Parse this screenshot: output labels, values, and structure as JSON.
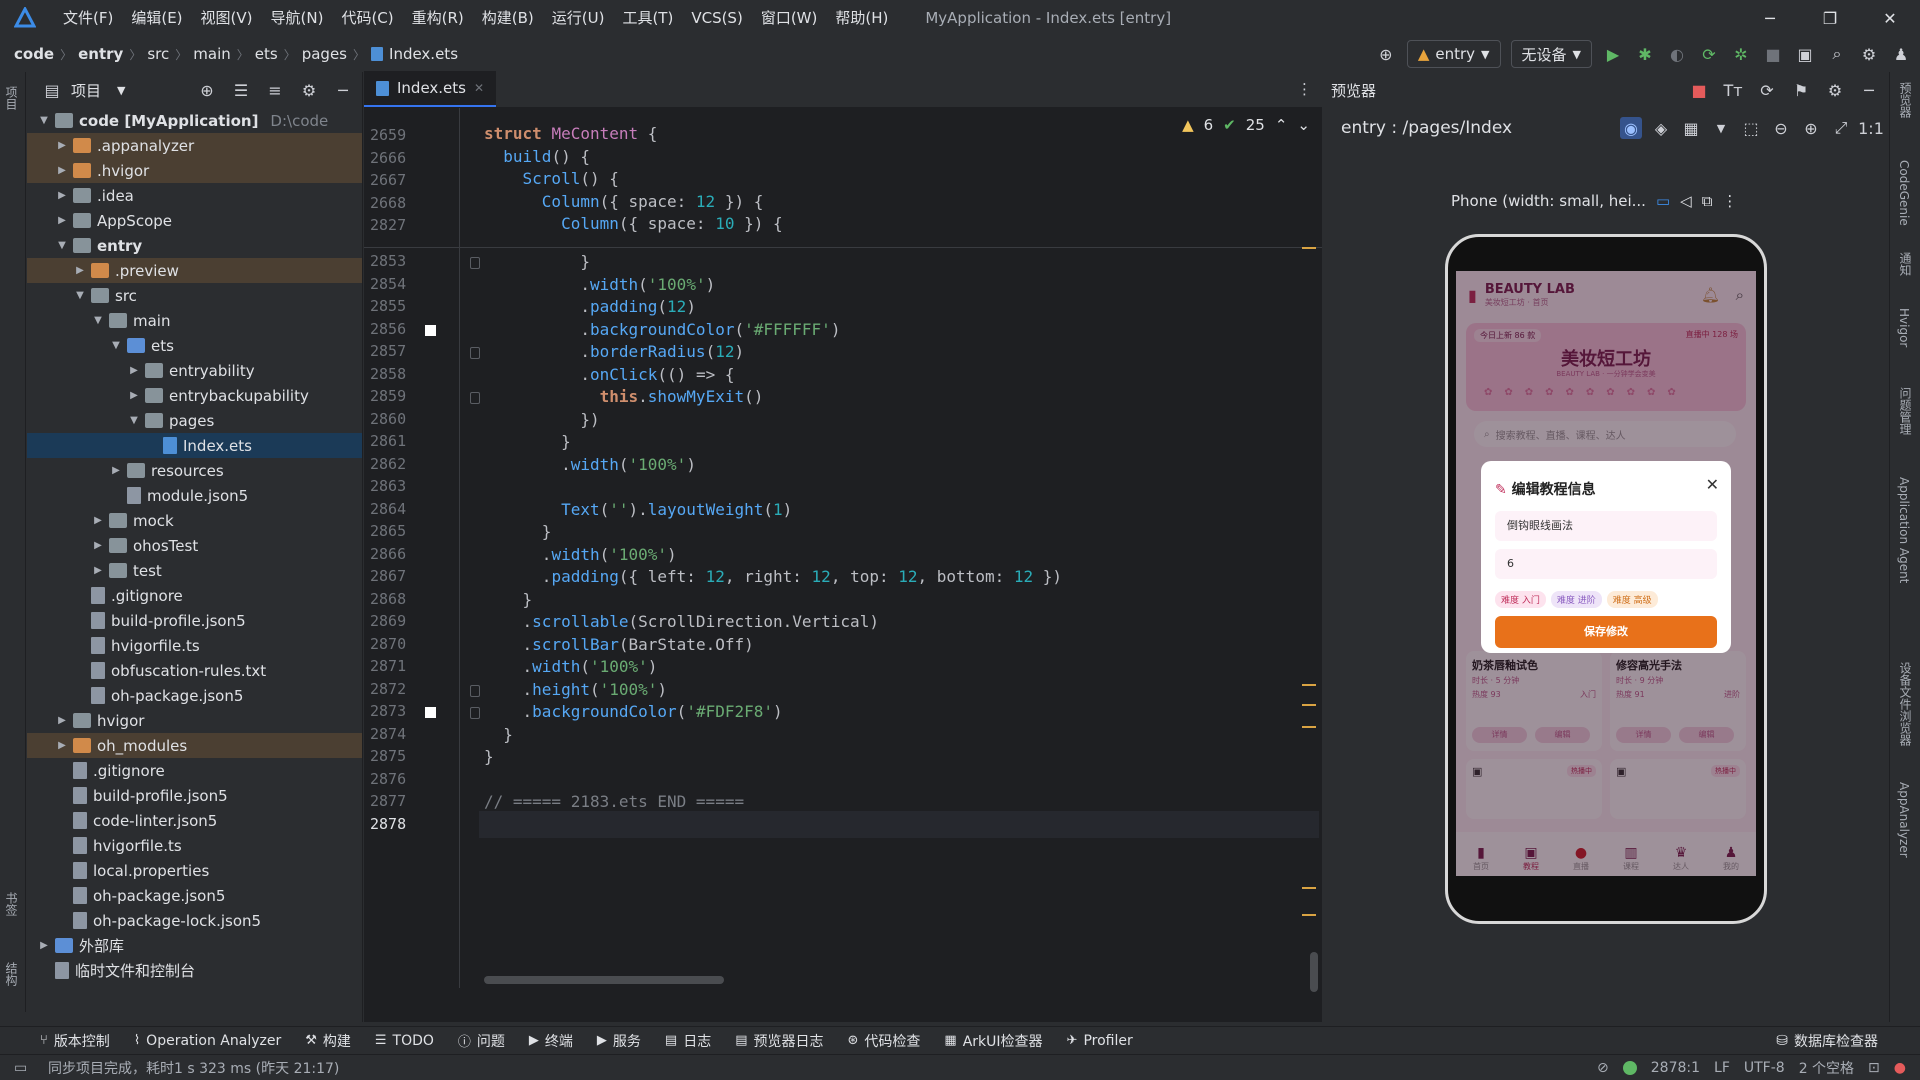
{
  "titlebar": {
    "menu": [
      "文件(F)",
      "编辑(E)",
      "视图(V)",
      "导航(N)",
      "代码(C)",
      "重构(R)",
      "构建(B)",
      "运行(U)",
      "工具(T)",
      "VCS(S)",
      "窗口(W)",
      "帮助(H)"
    ],
    "window_title": "MyApplication - Index.ets [entry]"
  },
  "breadcrumb": [
    "code",
    "entry",
    "src",
    "main",
    "ets",
    "pages",
    "Index.ets"
  ],
  "toolbar": {
    "module": "entry",
    "device": "无设备"
  },
  "project_panel": {
    "title": "项目",
    "tree": [
      {
        "depth": 0,
        "arrow": "open",
        "icon": "folder",
        "label": "code [MyApplication]",
        "hint": "D:\\code",
        "bold": true
      },
      {
        "depth": 1,
        "arrow": "closed",
        "icon": "folder-orange",
        "label": ".appanalyzer",
        "excluded": true
      },
      {
        "depth": 1,
        "arrow": "closed",
        "icon": "folder-orange",
        "label": ".hvigor",
        "excluded": true
      },
      {
        "depth": 1,
        "arrow": "closed",
        "icon": "folder",
        "label": ".idea"
      },
      {
        "depth": 1,
        "arrow": "closed",
        "icon": "folder",
        "label": "AppScope"
      },
      {
        "depth": 1,
        "arrow": "open",
        "icon": "folder",
        "label": "entry",
        "bold": true
      },
      {
        "depth": 2,
        "arrow": "closed",
        "icon": "folder-orange",
        "label": ".preview",
        "excluded": true
      },
      {
        "depth": 2,
        "arrow": "open",
        "icon": "folder",
        "label": "src"
      },
      {
        "depth": 3,
        "arrow": "open",
        "icon": "folder",
        "label": "main"
      },
      {
        "depth": 4,
        "arrow": "open",
        "icon": "folder-blue",
        "label": "ets"
      },
      {
        "depth": 5,
        "arrow": "closed",
        "icon": "folder",
        "label": "entryability"
      },
      {
        "depth": 5,
        "arrow": "closed",
        "icon": "folder",
        "label": "entrybackupability"
      },
      {
        "depth": 5,
        "arrow": "open",
        "icon": "folder",
        "label": "pages"
      },
      {
        "depth": 6,
        "arrow": "none",
        "icon": "file-ets",
        "label": "Index.ets",
        "selected": true
      },
      {
        "depth": 4,
        "arrow": "closed",
        "icon": "folder",
        "label": "resources"
      },
      {
        "depth": 4,
        "arrow": "none",
        "icon": "file",
        "label": "module.json5"
      },
      {
        "depth": 3,
        "arrow": "closed",
        "icon": "folder",
        "label": "mock"
      },
      {
        "depth": 3,
        "arrow": "closed",
        "icon": "folder",
        "label": "ohosTest"
      },
      {
        "depth": 3,
        "arrow": "closed",
        "icon": "folder",
        "label": "test"
      },
      {
        "depth": 2,
        "arrow": "none",
        "icon": "file",
        "label": ".gitignore"
      },
      {
        "depth": 2,
        "arrow": "none",
        "icon": "file",
        "label": "build-profile.json5"
      },
      {
        "depth": 2,
        "arrow": "none",
        "icon": "file",
        "label": "hvigorfile.ts"
      },
      {
        "depth": 2,
        "arrow": "none",
        "icon": "file",
        "label": "obfuscation-rules.txt"
      },
      {
        "depth": 2,
        "arrow": "none",
        "icon": "file",
        "label": "oh-package.json5"
      },
      {
        "depth": 1,
        "arrow": "closed",
        "icon": "folder",
        "label": "hvigor"
      },
      {
        "depth": 1,
        "arrow": "closed",
        "icon": "folder-orange",
        "label": "oh_modules",
        "excluded": true
      },
      {
        "depth": 1,
        "arrow": "none",
        "icon": "file",
        "label": ".gitignore"
      },
      {
        "depth": 1,
        "arrow": "none",
        "icon": "file",
        "label": "build-profile.json5"
      },
      {
        "depth": 1,
        "arrow": "none",
        "icon": "file",
        "label": "code-linter.json5"
      },
      {
        "depth": 1,
        "arrow": "none",
        "icon": "file",
        "label": "hvigorfile.ts"
      },
      {
        "depth": 1,
        "arrow": "none",
        "icon": "file",
        "label": "local.properties"
      },
      {
        "depth": 1,
        "arrow": "none",
        "icon": "file",
        "label": "oh-package.json5"
      },
      {
        "depth": 1,
        "arrow": "none",
        "icon": "file",
        "label": "oh-package-lock.json5"
      },
      {
        "depth": 0,
        "arrow": "closed",
        "icon": "library",
        "label": "外部库"
      },
      {
        "depth": 0,
        "arrow": "none",
        "icon": "scratch",
        "label": "临时文件和控制台"
      }
    ]
  },
  "editor": {
    "tab": "Index.ets",
    "warnings": "6",
    "checks": "25",
    "sticky": [
      {
        "ln": "2659",
        "html": "<span class='kw'>struct</span> <span class='cls'>MeContent</span> {"
      },
      {
        "ln": "2666",
        "html": "  <span class='fn'>build</span>() {"
      },
      {
        "ln": "2667",
        "html": "    <span class='fn'>Scroll</span>() {"
      },
      {
        "ln": "2668",
        "html": "      <span class='fn'>Column</span>({ space: <span class='nu'>12</span> }) {"
      },
      {
        "ln": "2827",
        "html": "        <span class='fn'>Column</span>({ space: <span class='nu'>10</span> }) {"
      }
    ],
    "lines": [
      {
        "ln": "2853",
        "html": "          }"
      },
      {
        "ln": "2854",
        "html": "          .<span class='fn'>width</span>(<span class='st'>'100%'</span>)"
      },
      {
        "ln": "2855",
        "html": "          .<span class='fn'>padding</span>(<span class='nu'>12</span>)"
      },
      {
        "ln": "2856",
        "html": "          .<span class='fn'>backgroundColor</span>(<span class='st'>'#FFFFFF'</span>)",
        "marker": true
      },
      {
        "ln": "2857",
        "html": "          .<span class='fn'>borderRadius</span>(<span class='nu'>12</span>)"
      },
      {
        "ln": "2858",
        "html": "          .<span class='fn'>onClick</span>(() => {"
      },
      {
        "ln": "2859",
        "html": "            <span class='kw'>this</span>.<span class='fn'>showMyExit</span>()"
      },
      {
        "ln": "2860",
        "html": "          })"
      },
      {
        "ln": "2861",
        "html": "        }"
      },
      {
        "ln": "2862",
        "html": "        .<span class='fn'>width</span>(<span class='st'>'100%'</span>)"
      },
      {
        "ln": "2863",
        "html": ""
      },
      {
        "ln": "2864",
        "html": "        <span class='fn'>Text</span>(<span class='st'>''</span>).<span class='fn'>layoutWeight</span>(<span class='nu'>1</span>)"
      },
      {
        "ln": "2865",
        "html": "      }"
      },
      {
        "ln": "2866",
        "html": "      .<span class='fn'>width</span>(<span class='st'>'100%'</span>)"
      },
      {
        "ln": "2867",
        "html": "      .<span class='fn'>padding</span>({ left: <span class='nu'>12</span>, right: <span class='nu'>12</span>, top: <span class='nu'>12</span>, bottom: <span class='nu'>12</span> })"
      },
      {
        "ln": "2868",
        "html": "    }"
      },
      {
        "ln": "2869",
        "html": "    .<span class='fn'>scrollable</span>(ScrollDirection.Vertical)"
      },
      {
        "ln": "2870",
        "html": "    .<span class='fn'>scrollBar</span>(BarState.Off)"
      },
      {
        "ln": "2871",
        "html": "    .<span class='fn'>width</span>(<span class='st'>'100%'</span>)"
      },
      {
        "ln": "2872",
        "html": "    .<span class='fn'>height</span>(<span class='st'>'100%'</span>)"
      },
      {
        "ln": "2873",
        "html": "    .<span class='fn'>backgroundColor</span>(<span class='st'>'#FDF2F8'</span>)",
        "marker": true
      },
      {
        "ln": "2874",
        "html": "  }"
      },
      {
        "ln": "2875",
        "html": "}"
      },
      {
        "ln": "2876",
        "html": ""
      },
      {
        "ln": "2877",
        "html": "<span class='cm'>// ===== 2183.ets END =====</span>"
      },
      {
        "ln": "2878",
        "html": "",
        "current": true
      }
    ]
  },
  "previewer": {
    "title": "预览器",
    "route": "entry : /pages/Index",
    "device_label": "Phone (width: small, hei...",
    "app": {
      "brand": "BEAUTY LAB",
      "brand_sub": "美妆短工坊 · 首页",
      "banner_left": "今日上新 86 款",
      "banner_right": "直播中 128 场",
      "hero_title": "美妆短工坊",
      "hero_sub": "BEAUTY LAB · 一分钟学会变美",
      "search_placeholder": "搜索教程、直播、课程、达人",
      "modal_title": "编辑教程信息",
      "modal_field1": "倒钩眼线画法",
      "modal_field2": "6",
      "chips": [
        "难度 入门",
        "难度 进阶",
        "难度 高级"
      ],
      "save": "保存修改",
      "cards": [
        {
          "name": "奶茶唇釉试色",
          "meta": "时长 · 5 分钟",
          "heat": "热度 93",
          "tag": "入门",
          "b1": "详情",
          "b2": "编辑"
        },
        {
          "name": "修容高光手法",
          "meta": "时长 · 9 分钟",
          "heat": "热度 91",
          "tag": "进阶",
          "b1": "详情",
          "b2": "编辑"
        }
      ],
      "live_tag": "热播中",
      "tabs": [
        "首页",
        "教程",
        "直播",
        "课程",
        "达人",
        "我的"
      ]
    }
  },
  "right_strip": [
    "预览器",
    "CodeGenie",
    "通知",
    "Hvigor",
    "问题管理",
    "Application Agent",
    "设备文件浏览器",
    "AppAnalyzer"
  ],
  "left_strip": [
    "项目",
    "书签",
    "结构"
  ],
  "tool_windows": [
    "版本控制",
    "Operation Analyzer",
    "构建",
    "TODO",
    "问题",
    "终端",
    "服务",
    "日志",
    "预览器日志",
    "代码检查",
    "ArkUI检查器",
    "Profiler"
  ],
  "tool_window_right": "数据库检查器",
  "status": {
    "message": "同步项目完成，耗时1 s 323 ms (昨天 21:17)",
    "position": "2878:1",
    "line_sep": "LF",
    "encoding": "UTF-8",
    "indent": "2 个空格"
  }
}
